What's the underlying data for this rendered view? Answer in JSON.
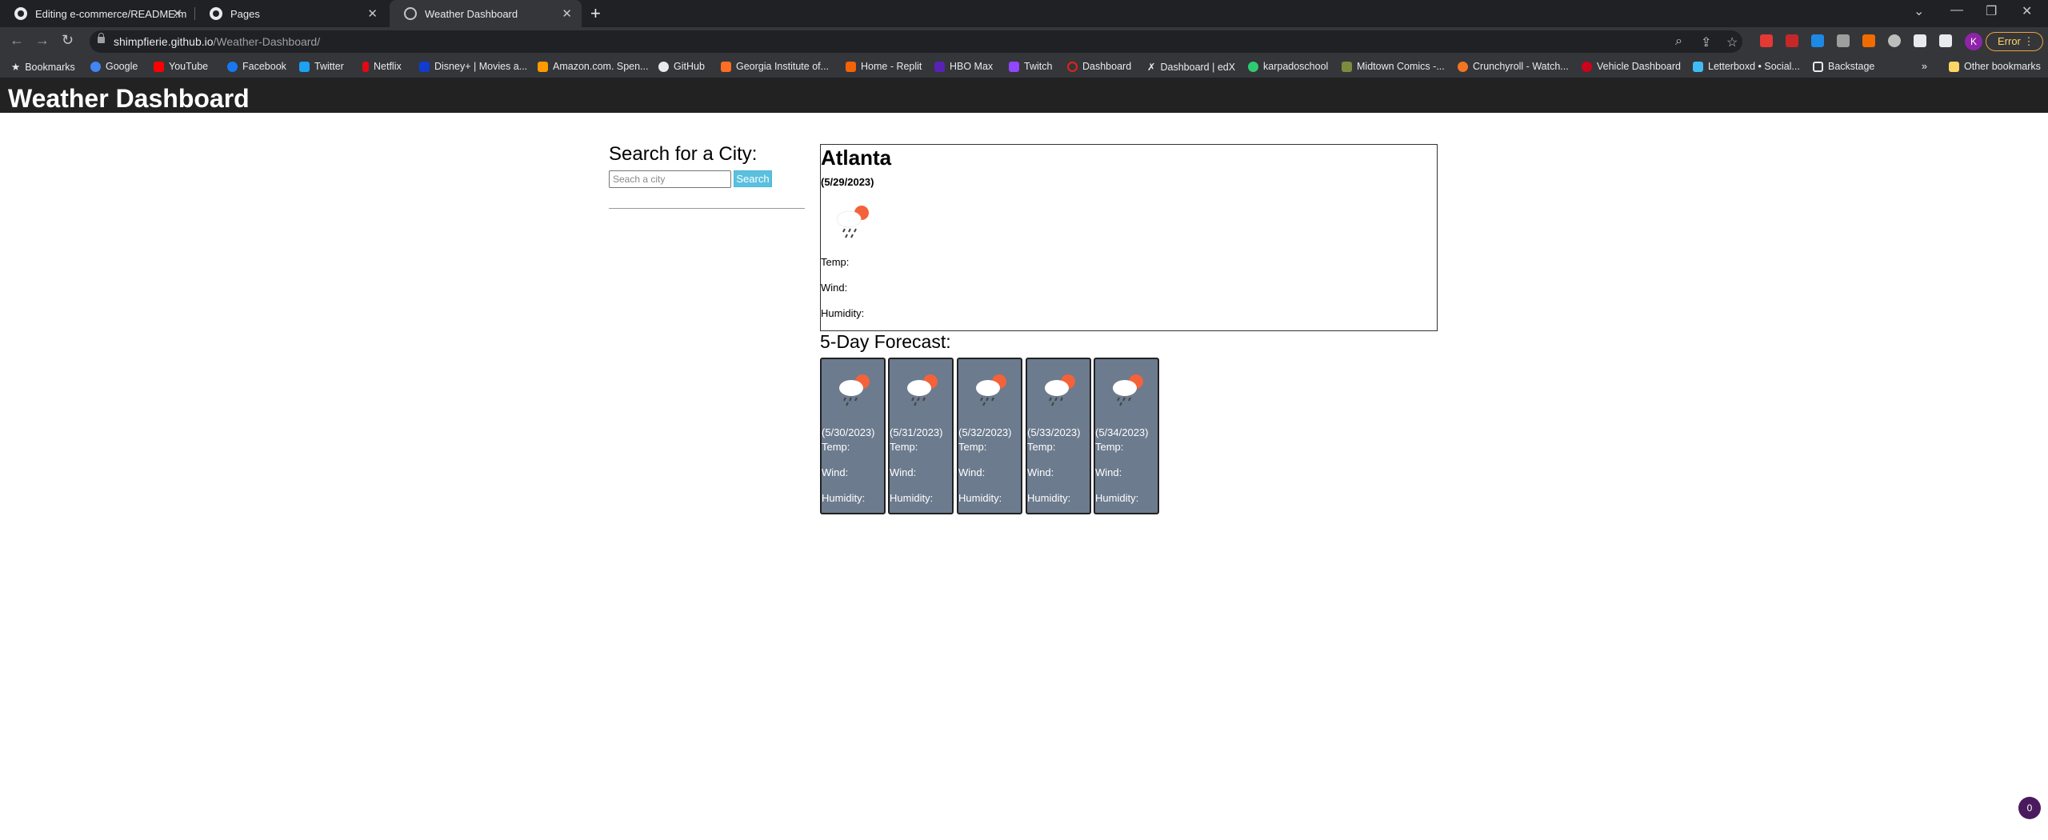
{
  "browser": {
    "tabs": [
      {
        "title": "Editing e-commerce/README.m",
        "icon": "github-icon"
      },
      {
        "title": "Pages",
        "icon": "github-icon"
      },
      {
        "title": "Weather Dashboard",
        "icon": "globe-icon"
      }
    ],
    "url_domain": "shimpfierie.github.io",
    "url_path": "/Weather-Dashboard/",
    "profile_initial": "K",
    "error_label": "Error",
    "bookmarks": [
      {
        "label": "Bookmarks",
        "color": "#e8eaed"
      },
      {
        "label": "Google",
        "color": "#4285f4"
      },
      {
        "label": "YouTube",
        "color": "#ff0000"
      },
      {
        "label": "Facebook",
        "color": "#1877f2"
      },
      {
        "label": "Twitter",
        "color": "#1da1f2"
      },
      {
        "label": "Netflix",
        "color": "#e50914"
      },
      {
        "label": "Disney+ | Movies a...",
        "color": "#113ccf"
      },
      {
        "label": "Amazon.com. Spen...",
        "color": "#ff9900"
      },
      {
        "label": "GitHub",
        "color": "#e8eaed"
      },
      {
        "label": "Georgia Institute of...",
        "color": "#fc6d26"
      },
      {
        "label": "Home - Replit",
        "color": "#f26207"
      },
      {
        "label": "HBO Max",
        "color": "#5822b4"
      },
      {
        "label": "Twitch",
        "color": "#9146ff"
      },
      {
        "label": "Dashboard",
        "color": "#e2231a"
      },
      {
        "label": "Dashboard | edX",
        "color": "#e8eaed"
      },
      {
        "label": "karpadoschool",
        "color": "#2ecc71"
      },
      {
        "label": "Midtown Comics -...",
        "color": "#7c8c3c"
      },
      {
        "label": "Crunchyroll - Watch...",
        "color": "#f47521"
      },
      {
        "label": "Vehicle Dashboard",
        "color": "#d0021b"
      },
      {
        "label": "Letterboxd • Social...",
        "color": "#40bcf4"
      },
      {
        "label": "Backstage",
        "color": "#e8eaed"
      }
    ],
    "other_bookmarks": "Other bookmarks",
    "overflow_chevron": "»"
  },
  "page": {
    "title": "Weather Dashboard",
    "search": {
      "heading": "Search for a City:",
      "placeholder": "Seach a city",
      "button_label": "Search"
    },
    "current": {
      "city": "Atlanta",
      "date": "(5/29/2023)",
      "icon": "rain-cloud-sun-icon",
      "temp_label": "Temp:",
      "wind_label": "Wind:",
      "humidity_label": "Humidity:"
    },
    "forecast_heading": "5-Day Forecast:",
    "forecast": [
      {
        "date": "(5/30/2023)",
        "temp": "Temp:",
        "wind": "Wind:",
        "humidity": "Humidity:"
      },
      {
        "date": "(5/31/2023)",
        "temp": "Temp:",
        "wind": "Wind:",
        "humidity": "Humidity:"
      },
      {
        "date": "(5/32/2023)",
        "temp": "Temp:",
        "wind": "Wind:",
        "humidity": "Humidity:"
      },
      {
        "date": "(5/33/2023)",
        "temp": "Temp:",
        "wind": "Wind:",
        "humidity": "Humidity:"
      },
      {
        "date": "(5/34/2023)",
        "temp": "Temp:",
        "wind": "Wind:",
        "humidity": "Humidity:"
      }
    ],
    "notification_count": "0"
  }
}
